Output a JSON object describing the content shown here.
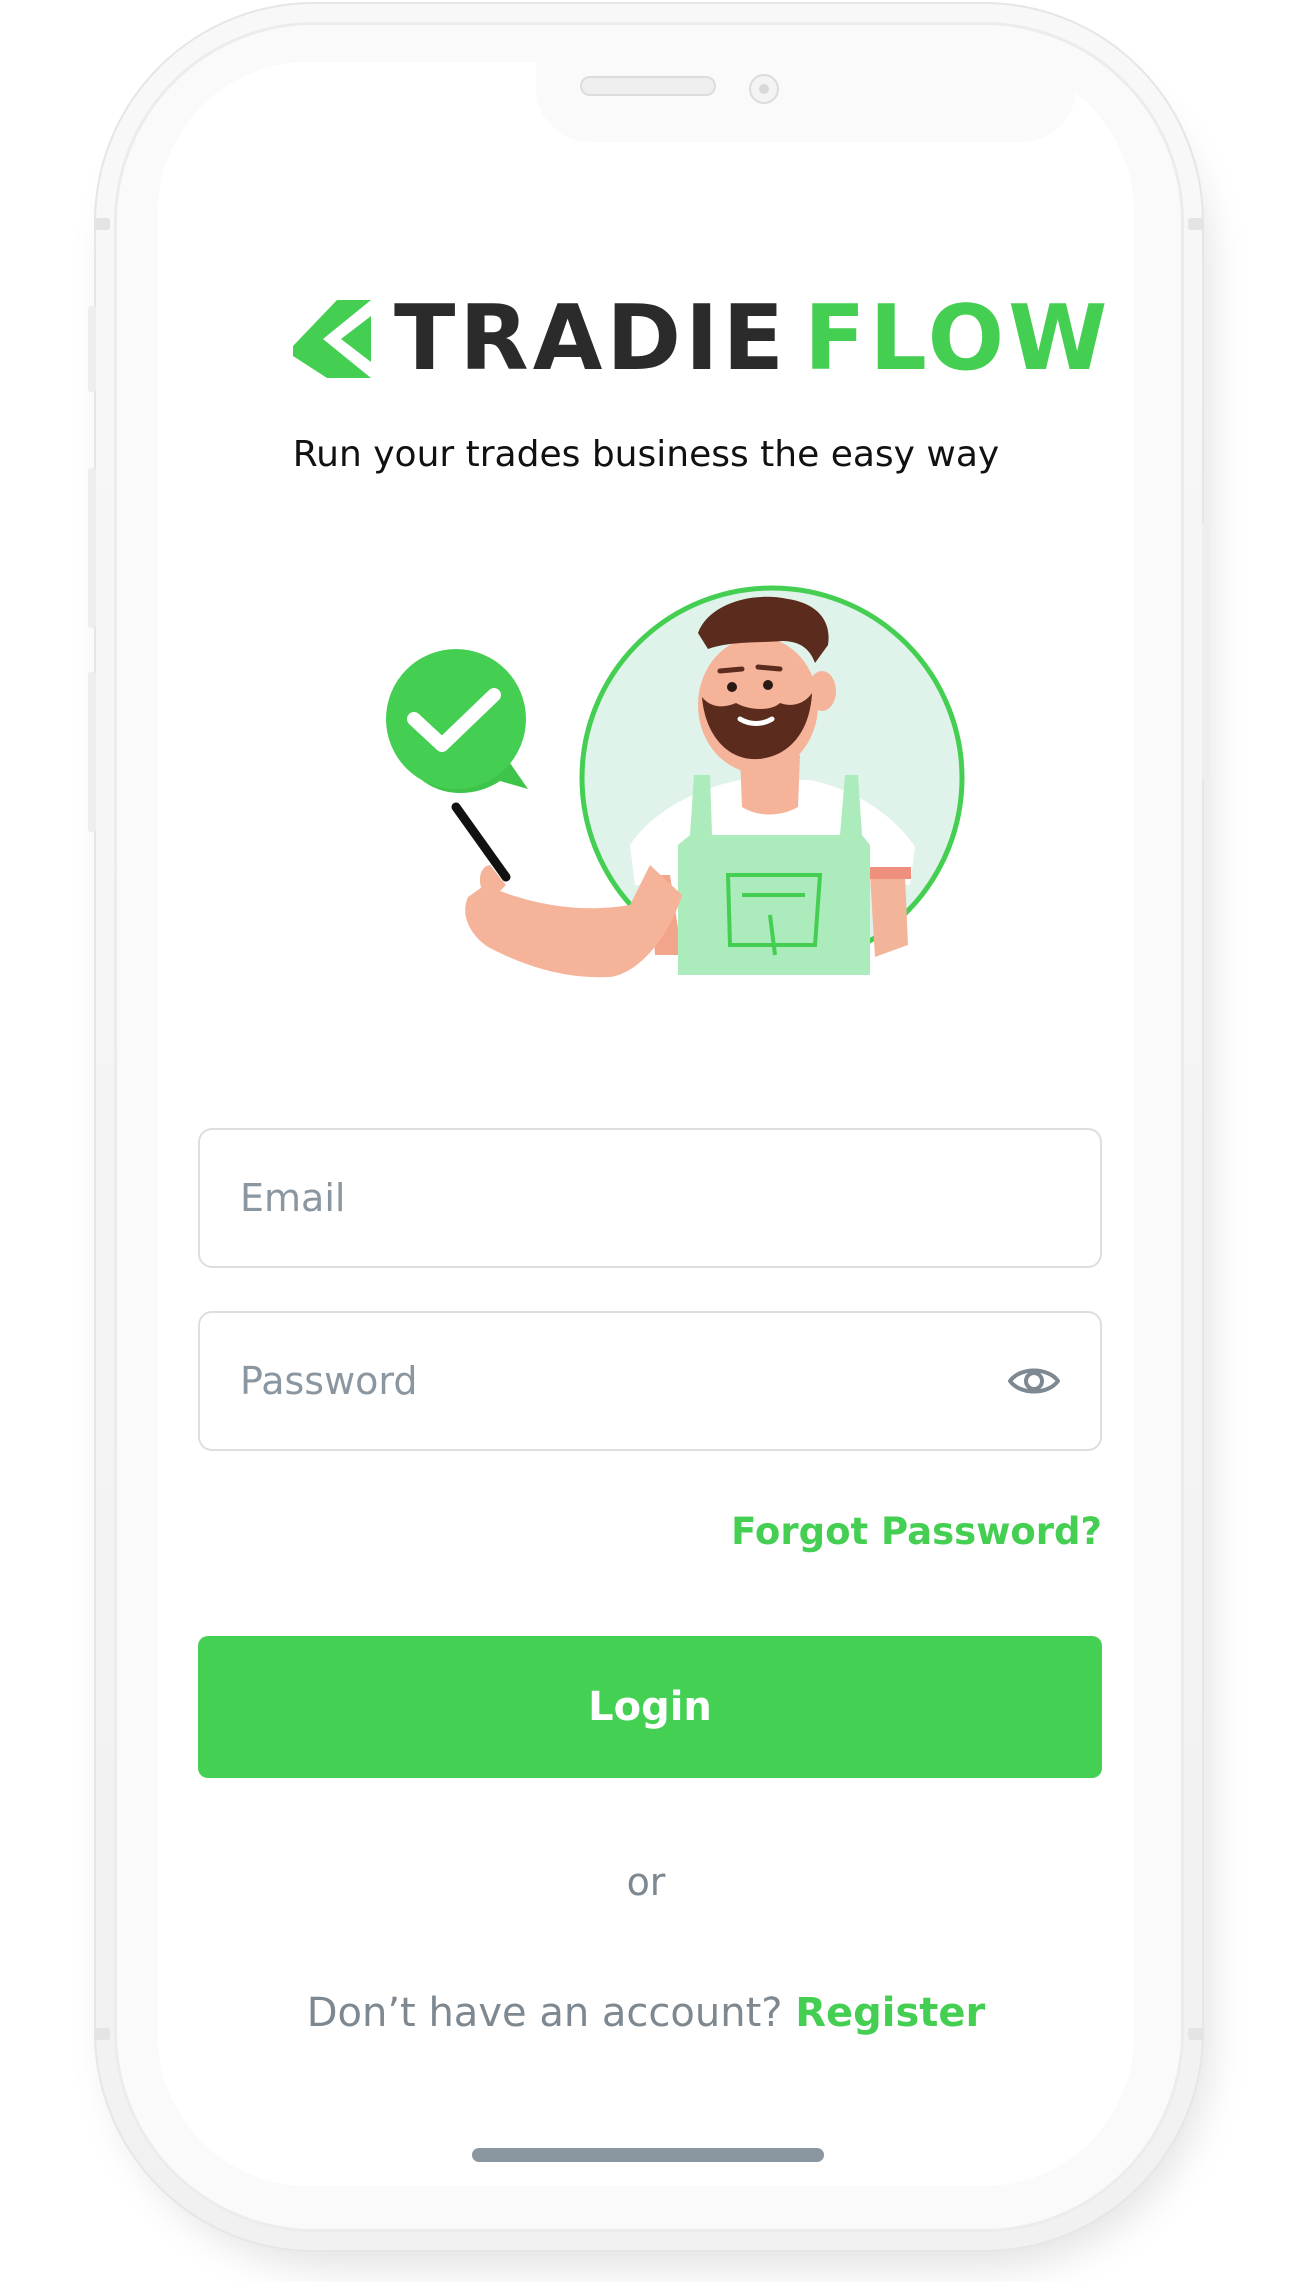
{
  "brand": {
    "name_part1": "TRADIE",
    "name_part2": "FLOW",
    "tagline": "Run your trades business the easy way",
    "accent_color": "#44cf52",
    "dark_color": "#2b2b2b"
  },
  "illustration": {
    "icons": [
      "check-bubble-icon",
      "smartphone-icon",
      "tradesman-avatar"
    ]
  },
  "form": {
    "email": {
      "placeholder": "Email",
      "value": ""
    },
    "password": {
      "placeholder": "Password",
      "value": "",
      "toggle_icon": "eye-icon"
    },
    "forgot_label": "Forgot Password?",
    "login_label": "Login",
    "separator": "or",
    "register_prompt": "Don’t have an account?",
    "register_label": "Register"
  }
}
